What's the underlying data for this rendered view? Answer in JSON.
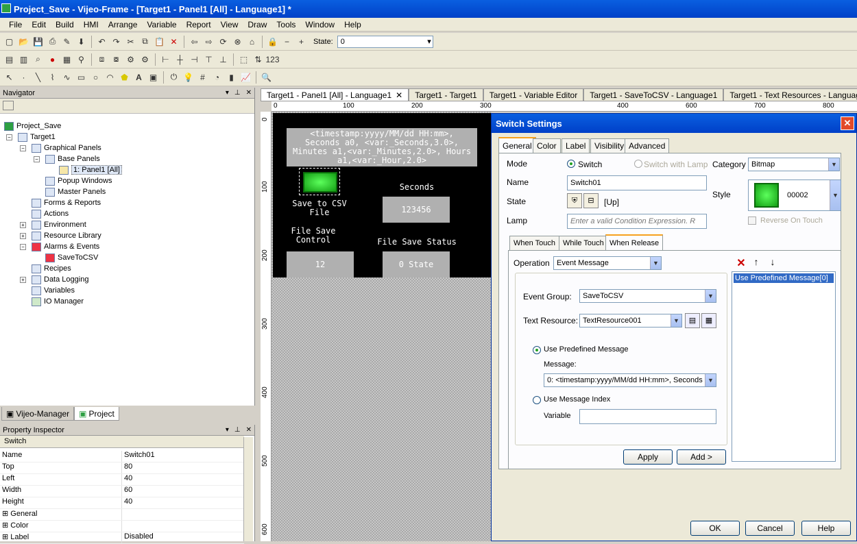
{
  "window": {
    "title": "Project_Save - Vijeo-Frame - [Target1 - Panel1 [All] - Language1] *"
  },
  "menu": [
    "File",
    "Edit",
    "Build",
    "HMI",
    "Arrange",
    "Variable",
    "Report",
    "View",
    "Draw",
    "Tools",
    "Window",
    "Help"
  ],
  "toolbar": {
    "state_label": "State:",
    "state_value": "0"
  },
  "navigator": {
    "title": "Navigator",
    "tree": [
      {
        "label": "Project_Save",
        "level": 0
      },
      {
        "label": "Target1",
        "level": 1
      },
      {
        "label": "Graphical Panels",
        "level": 2
      },
      {
        "label": "Base Panels",
        "level": 3
      },
      {
        "label": "1: Panel1 [All]",
        "level": 4
      },
      {
        "label": "Popup Windows",
        "level": 3
      },
      {
        "label": "Master Panels",
        "level": 3
      },
      {
        "label": "Forms & Reports",
        "level": 2
      },
      {
        "label": "Actions",
        "level": 2
      },
      {
        "label": "Environment",
        "level": 2
      },
      {
        "label": "Resource Library",
        "level": 2
      },
      {
        "label": "Alarms & Events",
        "level": 2
      },
      {
        "label": "SaveToCSV",
        "level": 3
      },
      {
        "label": "Recipes",
        "level": 2
      },
      {
        "label": "Data Logging",
        "level": 2
      },
      {
        "label": "Variables",
        "level": 2
      },
      {
        "label": "IO Manager",
        "level": 2
      }
    ],
    "tabs": [
      "Vijeo-Manager",
      "Project"
    ]
  },
  "property_inspector": {
    "title": "Property Inspector",
    "object": "Switch",
    "rows": [
      {
        "k": "Name",
        "v": "Switch01"
      },
      {
        "k": "Top",
        "v": "80"
      },
      {
        "k": "Left",
        "v": "40"
      },
      {
        "k": "Width",
        "v": "60"
      },
      {
        "k": "Height",
        "v": "40"
      },
      {
        "k": "General",
        "v": ""
      },
      {
        "k": "Color",
        "v": ""
      },
      {
        "k": "Label",
        "v": "Disabled"
      }
    ]
  },
  "doc_tabs": [
    "Target1 - Panel1 [All] - Language1",
    "Target1 - Target1",
    "Target1 - Variable Editor",
    "Target1 - SaveToCSV - Language1",
    "Target1 - Text Resources - Language1"
  ],
  "rulers": {
    "h": [
      "0",
      "100",
      "200",
      "300",
      "400",
      "500",
      "600",
      "700",
      "800"
    ],
    "v": [
      "0",
      "100",
      "200",
      "300",
      "400",
      "500",
      "600"
    ]
  },
  "hmi": {
    "message_box": "<timestamp:yyyy/MM/dd HH:mm>, Seconds a0, <var:_Seconds,3.0>, Minutes a1,<var:_Minutes,2.0>, Hours a1,<var:_Hour,2.0>",
    "switch_label": "Save to CSV File",
    "seconds_label": "Seconds",
    "seconds_value": "123456",
    "file_save_control_label": "File Save Control",
    "file_save_status_label": "File Save Status",
    "control_value": "12",
    "status_value": "0 State"
  },
  "dialog": {
    "title": "Switch Settings",
    "tabs": [
      "General",
      "Color",
      "Label",
      "Visibility",
      "Advanced"
    ],
    "mode_label": "Mode",
    "mode_switch": "Switch",
    "mode_lamp": "Switch with Lamp",
    "category_label": "Category",
    "category_value": "Bitmap",
    "name_label": "Name",
    "name_value": "Switch01",
    "state_label": "State",
    "state_value": "[Up]",
    "style_label": "Style",
    "style_value": "00002",
    "lamp_label": "Lamp",
    "lamp_placeholder": "Enter a valid Condition Expression. R",
    "reverse_label": "Reverse On Touch",
    "sub_tabs": [
      "When Touch",
      "While Touch",
      "When Release"
    ],
    "operation_label": "Operation",
    "operation_value": "Event Message",
    "event_group_label": "Event Group:",
    "event_group_value": "SaveToCSV",
    "text_resource_label": "Text Resource:",
    "text_resource_value": "TextResource001",
    "use_predefined_label": "Use Predefined Message",
    "message_label": "Message:",
    "message_value": "0: <timestamp:yyyy/MM/dd HH:mm>, Seconds",
    "use_index_label": "Use Message Index",
    "variable_label": "Variable",
    "apply": "Apply",
    "add": "Add >",
    "list_items": [
      "Use Predefined Message[0]"
    ],
    "ok": "OK",
    "cancel": "Cancel",
    "help": "Help"
  }
}
